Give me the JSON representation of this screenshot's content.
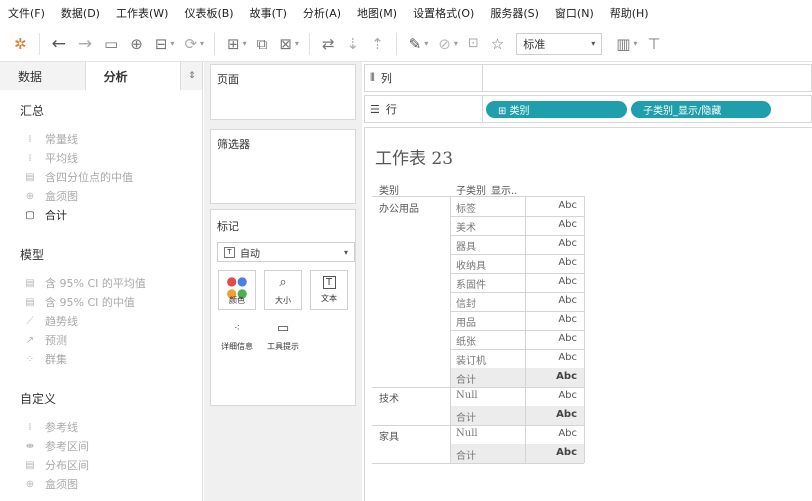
{
  "menu": [
    "文件(F)",
    "数据(D)",
    "工作表(W)",
    "仪表板(B)",
    "故事(T)",
    "分析(A)",
    "地图(M)",
    "设置格式(O)",
    "服务器(S)",
    "窗口(N)",
    "帮助(H)"
  ],
  "toolbar": {
    "fit_select": "标准",
    "icons": [
      "tableau-logo-icon",
      "back-arrow-icon",
      "forward-arrow-icon",
      "save-icon",
      "new-datasource-icon",
      "pause-updates-icon",
      "refresh-icon",
      "new-worksheet-icon",
      "duplicate-icon",
      "clear-sheet-icon",
      "swap-icon",
      "sort-ascending-icon",
      "sort-descending-icon",
      "highlight-icon",
      "group-icon",
      "labels-icon",
      "pin-icon",
      "show-me-icon",
      "presentation-icon"
    ]
  },
  "left_pane": {
    "tabs": {
      "data": "数据",
      "analysis": "分析",
      "toggle": "⇕"
    },
    "sections": {
      "summary": {
        "title": "汇总",
        "items": [
          {
            "label": "常量线",
            "icon": "constant-line-icon",
            "active": false
          },
          {
            "label": "平均线",
            "icon": "average-line-icon",
            "active": false
          },
          {
            "label": "含四分位点的中值",
            "icon": "median-quartiles-icon",
            "active": false
          },
          {
            "label": "盒须图",
            "icon": "box-plot-icon",
            "active": false
          },
          {
            "label": "合计",
            "icon": "totals-icon",
            "active": true
          }
        ]
      },
      "model": {
        "title": "模型",
        "items": [
          {
            "label": "含 95% CI 的平均值",
            "icon": "average-ci-icon"
          },
          {
            "label": "含 95% CI 的中值",
            "icon": "median-ci-icon"
          },
          {
            "label": "趋势线",
            "icon": "trend-line-icon"
          },
          {
            "label": "预测",
            "icon": "forecast-icon"
          },
          {
            "label": "群集",
            "icon": "cluster-icon"
          }
        ]
      },
      "custom": {
        "title": "自定义",
        "items": [
          {
            "label": "参考线",
            "icon": "reference-line-icon"
          },
          {
            "label": "参考区间",
            "icon": "reference-band-icon"
          },
          {
            "label": "分布区间",
            "icon": "distribution-band-icon"
          },
          {
            "label": "盒须图",
            "icon": "box-plot-icon"
          }
        ]
      }
    }
  },
  "cards": {
    "pages": "页面",
    "filters": "筛选器",
    "marks": {
      "title": "标记",
      "type": "自动",
      "buttons": [
        "颜色",
        "大小",
        "文本",
        "详细信息",
        "工具提示"
      ]
    }
  },
  "shelves": {
    "columns_label": "列",
    "rows_label": "行",
    "rows_pills": [
      "⊞ 类别",
      "子类别_显示/隐藏"
    ]
  },
  "worksheet": {
    "title": "工作表 23",
    "headers": [
      "类别",
      "子类别_显示.."
    ],
    "value_text": "Abc",
    "groups": [
      {
        "category": "办公用品",
        "subs": [
          "标签",
          "美术",
          "器具",
          "收纳具",
          "系固件",
          "信封",
          "用品",
          "纸张",
          "装订机",
          "合计"
        ]
      },
      {
        "category": "技术",
        "subs": [
          "Null",
          "合计"
        ]
      },
      {
        "category": "家具",
        "subs": [
          "Null",
          "合计"
        ]
      }
    ]
  }
}
